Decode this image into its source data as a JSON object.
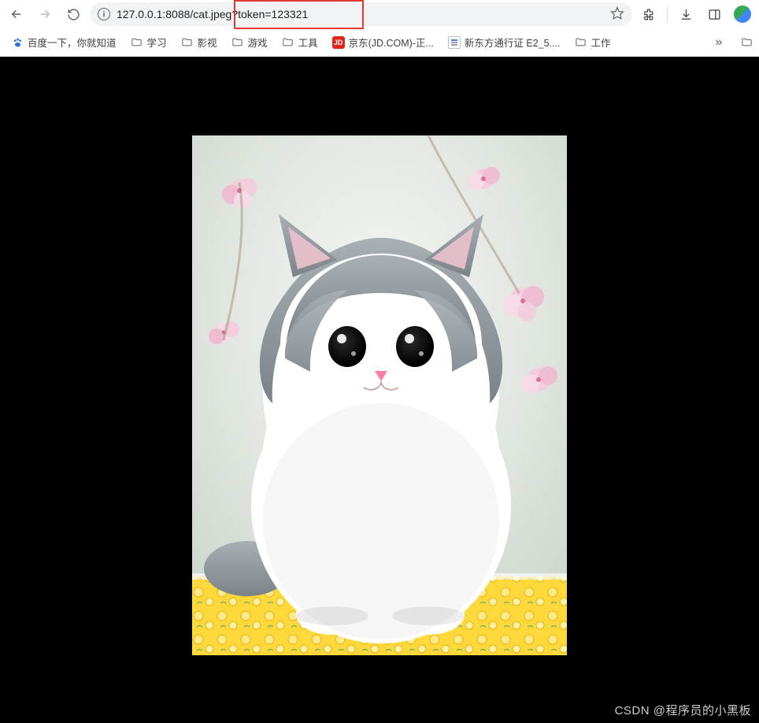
{
  "toolbar": {
    "back_tip": "Back",
    "forward_tip": "Forward",
    "reload_tip": "Reload",
    "url": "127.0.0.1:8088/cat.jpeg?token=123321",
    "star_tip": "Bookmark this page"
  },
  "bookmarks": {
    "items": [
      {
        "label": "百度一下，你就知道",
        "kind": "baidu"
      },
      {
        "label": "学习",
        "kind": "folder"
      },
      {
        "label": "影视",
        "kind": "folder"
      },
      {
        "label": "游戏",
        "kind": "folder"
      },
      {
        "label": "工具",
        "kind": "folder"
      },
      {
        "label": "京东(JD.COM)-正...",
        "kind": "jd"
      },
      {
        "label": "新东方通行证 E2_5....",
        "kind": "page"
      },
      {
        "label": "工作",
        "kind": "folder"
      }
    ],
    "overflow_label": ""
  },
  "image": {
    "alt": "cat.jpeg — a grey and white kitten sitting on a yellow patterned surface with cherry blossoms behind"
  },
  "watermark": "CSDN @程序员的小黑板"
}
